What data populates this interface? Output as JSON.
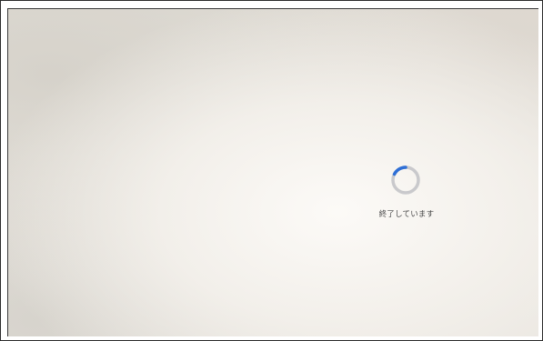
{
  "shutdown_screen": {
    "status_text": "終了しています",
    "spinner_color": "#2f6fd6",
    "spinner_track_color": "#c9c9cc"
  }
}
